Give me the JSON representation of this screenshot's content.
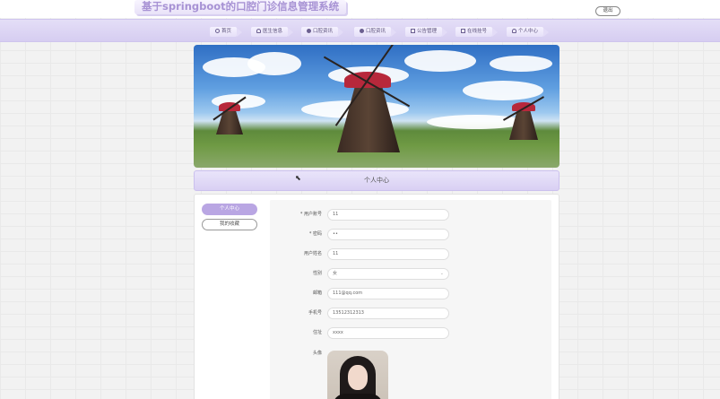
{
  "header": {
    "site_title": "基于springboot的口腔门诊信息管理系统",
    "logout_label": "退出"
  },
  "nav": {
    "items": [
      {
        "label": "首页",
        "icon": "home-icon"
      },
      {
        "label": "医生信息",
        "icon": "user-icon"
      },
      {
        "label": "口腔资讯",
        "icon": "news-icon"
      },
      {
        "label": "口腔资讯",
        "icon": "news-icon"
      },
      {
        "label": "公告管理",
        "icon": "notice-icon"
      },
      {
        "label": "在线挂号",
        "icon": "register-icon"
      },
      {
        "label": "个人中心",
        "icon": "person-icon"
      }
    ]
  },
  "section": {
    "title": "个人中心"
  },
  "sidebar": {
    "items": [
      {
        "label": "个人中心",
        "active": true
      },
      {
        "label": "我的收藏",
        "active": false
      }
    ]
  },
  "form": {
    "fields": [
      {
        "label": "* 用户账号",
        "value": "11"
      },
      {
        "label": "* 密码",
        "value": "••"
      },
      {
        "label": "用户姓名",
        "value": "11"
      },
      {
        "label": "性别",
        "value": "女"
      },
      {
        "label": "邮箱",
        "value": "111@qq.com"
      },
      {
        "label": "手机号",
        "value": "13512312313"
      },
      {
        "label": "住址",
        "value": "xxxx"
      }
    ],
    "avatar_label": "头像"
  },
  "colors": {
    "accent": "#b9a6e3",
    "nav_bg": "#d6cdf1",
    "title": "#a792d4"
  }
}
